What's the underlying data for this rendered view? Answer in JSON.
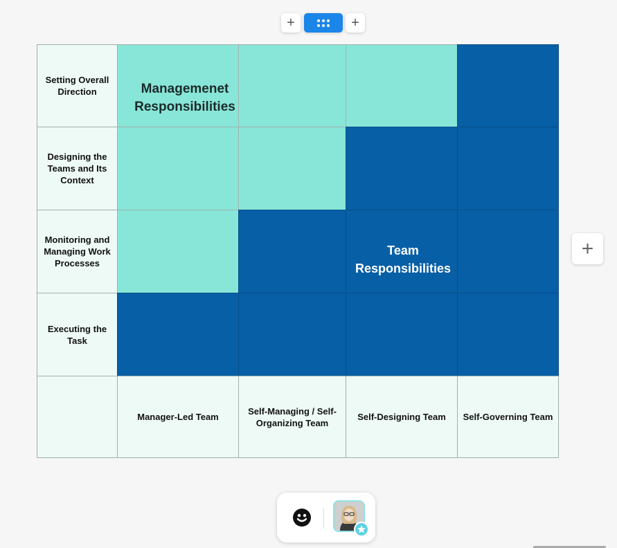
{
  "toolbar": {
    "add_left_icon": "plus-icon",
    "drag_icon": "grid-dots-icon",
    "add_right_icon": "plus-icon",
    "active_color": "#1a86e8"
  },
  "matrix": {
    "rows": [
      {
        "label": "Setting Overall Direction",
        "cells": [
          "management",
          "management",
          "management",
          "team"
        ]
      },
      {
        "label": "Designing the Teams and Its Context",
        "cells": [
          "management",
          "management",
          "team",
          "team"
        ]
      },
      {
        "label": "Monitoring and Managing Work Processes",
        "cells": [
          "management",
          "team",
          "team",
          "team"
        ]
      },
      {
        "label": "Executing the Task",
        "cells": [
          "team",
          "team",
          "team",
          "team"
        ]
      }
    ],
    "columns": [
      "Manager-Led Team",
      "Self-Managing / Self-Organizing Team",
      "Self-Designing Team",
      "Self-Governing Team"
    ],
    "management_label": "Managemenet Responsibilities",
    "team_label": "Team Responsibilities",
    "colors": {
      "management": "#88e6d8",
      "team": "#075fa6",
      "label_bg": "#eefaf6"
    }
  },
  "side_add_icon": "plus-icon",
  "reactions": {
    "emoji_icon": "smiley-icon",
    "avatar_badge_icon": "star-icon"
  }
}
